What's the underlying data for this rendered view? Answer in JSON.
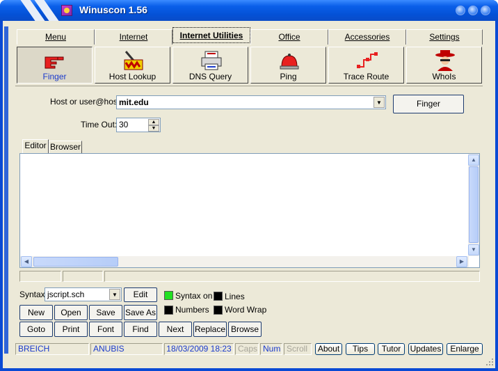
{
  "window": {
    "title": "Winuscon 1.56"
  },
  "menu_tabs": [
    {
      "label": "Menu"
    },
    {
      "label": "Internet"
    },
    {
      "label": "Internet Utilities"
    },
    {
      "label": "Office"
    },
    {
      "label": "Accessories"
    },
    {
      "label": "Settings"
    }
  ],
  "tools": [
    {
      "label": "Finger",
      "icon": "pointing-hand-icon"
    },
    {
      "label": "Host Lookup",
      "icon": "host-lookup-icon"
    },
    {
      "label": "DNS Query",
      "icon": "printer-icon"
    },
    {
      "label": "Ping",
      "icon": "bell-icon"
    },
    {
      "label": "Trace Route",
      "icon": "network-route-icon"
    },
    {
      "label": "WhoIs",
      "icon": "detective-icon"
    }
  ],
  "form": {
    "host_label": "Host or user@host:",
    "host_value": "mit.edu",
    "timeout_label": "Time Out:",
    "timeout_value": "30",
    "action_button": "Finger"
  },
  "editor_tabs": [
    {
      "label": "Editor"
    },
    {
      "label": "Browser"
    }
  ],
  "syntax": {
    "label": "Syntax",
    "value": "jscript.sch",
    "edit_button": "Edit",
    "syntax_on": "Syntax on",
    "lines": "Lines",
    "numbers": "Numbers",
    "word_wrap": "Word Wrap"
  },
  "editor_buttons_row1": [
    "New",
    "Open",
    "Save",
    "Save As"
  ],
  "editor_buttons_row2": [
    "Goto",
    "Print",
    "Font",
    "Find",
    "Next",
    "Replace",
    "Browse"
  ],
  "status": {
    "user": "BREICH",
    "machine": "ANUBIS",
    "datetime": "18/03/2009 18:23",
    "caps": "Caps",
    "num": "Num",
    "scroll": "Scroll",
    "buttons": [
      "About",
      "Tips",
      "Tutor",
      "Updates",
      "Enlarge"
    ]
  },
  "colors": {
    "titlebar": "#0a52d8",
    "face": "#ece9d8",
    "accent_blue": "#1a3acc",
    "syntax_green": "#22e022"
  }
}
